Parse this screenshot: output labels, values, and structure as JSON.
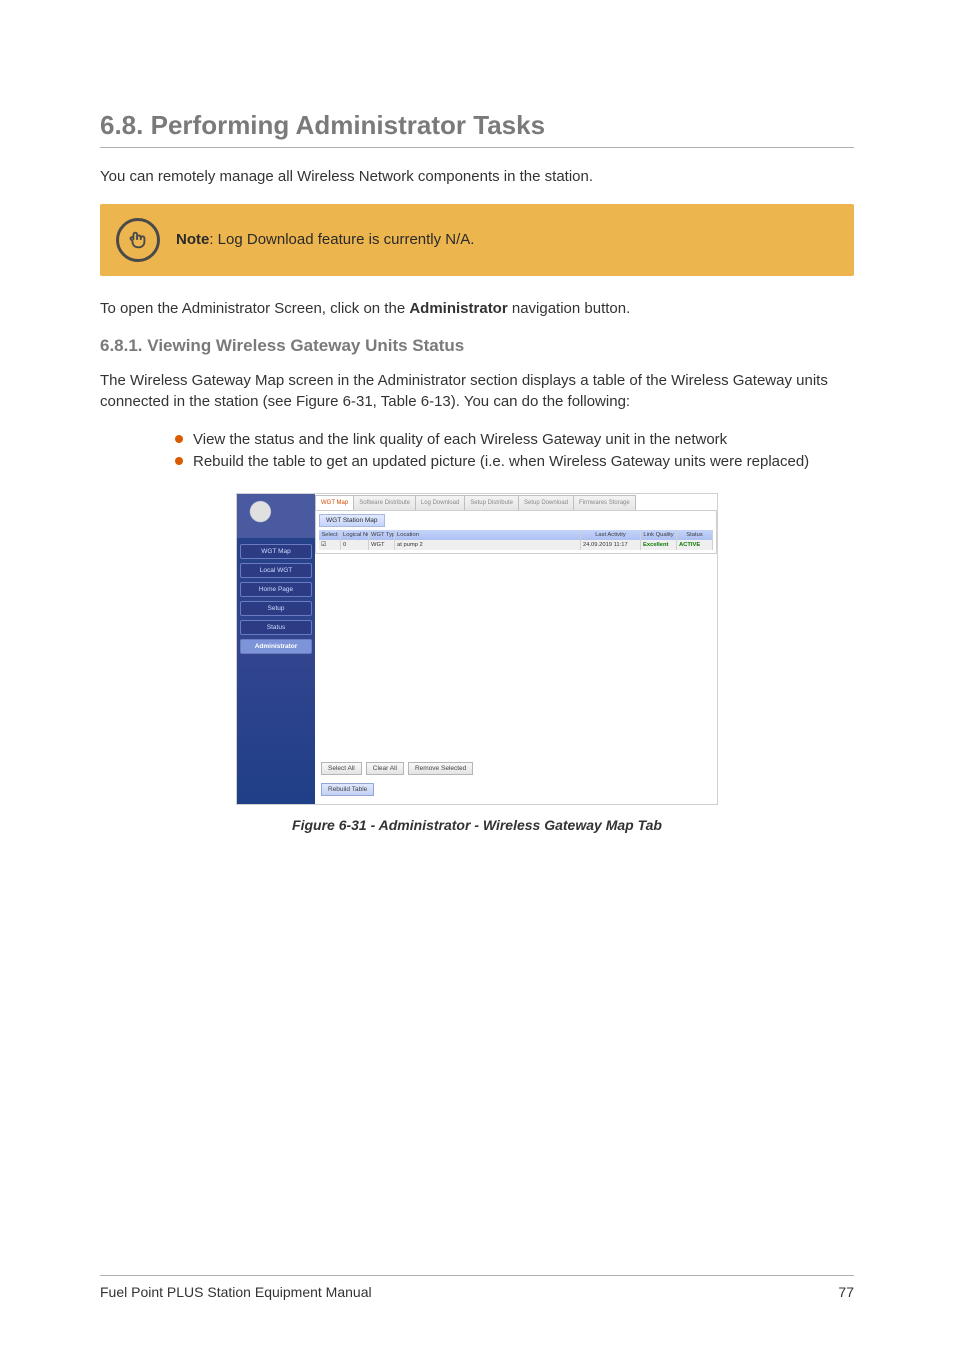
{
  "section": {
    "number": "6.8.",
    "title": "Performing Administrator Tasks"
  },
  "intro_paragraph": "You can remotely manage all Wireless Network components in the station.",
  "note": {
    "label": "Note",
    "text": ": Log Download feature is currently N/A.",
    "icon_name": "pointing-hand-icon"
  },
  "after_note_prefix": "To open the Administrator Screen, click on the ",
  "after_note_bold": "Administrator",
  "after_note_suffix": " navigation button.",
  "subsection": {
    "number": "6.8.1.",
    "title": "Viewing Wireless Gateway Units Status"
  },
  "subsection_paragraph": "The Wireless Gateway Map screen in the Administrator section displays a table of the Wireless Gateway units connected in the station (see Figure 6-31, Table 6-13). You can do the following:",
  "bullets": [
    "View the status and the link quality of each Wireless Gateway unit in the network",
    "Rebuild the table to get an updated picture (i.e. when Wireless Gateway units were replaced)"
  ],
  "embedded_app": {
    "nav_items": [
      {
        "label": "WGT Map",
        "active": false
      },
      {
        "label": "Local WGT",
        "active": false
      },
      {
        "label": "Home Page",
        "active": false
      },
      {
        "label": "Setup",
        "active": false
      },
      {
        "label": "Status",
        "active": false
      },
      {
        "label": "Administrator",
        "active": true
      }
    ],
    "tabs": [
      {
        "label": "WGT Map",
        "active": true
      },
      {
        "label": "Software Distribute",
        "active": false
      },
      {
        "label": "Log Download",
        "active": false
      },
      {
        "label": "Setup Distribute",
        "active": false
      },
      {
        "label": "Setup Download",
        "active": false
      },
      {
        "label": "Firmwares Storage",
        "active": false
      }
    ],
    "panel_title": "WGT Station Map",
    "table": {
      "headers": {
        "select": "Select",
        "logical_num": "Logical Num",
        "wgt_type": "WGT Type",
        "location": "Location",
        "last_activity": "Last Activity",
        "link_quality": "Link Quality",
        "status": "Status"
      },
      "rows": [
        {
          "select": true,
          "logical_num": "0",
          "wgt_type": "WGT",
          "location": "at pump 2",
          "last_activity": "24.09.2019 11:17",
          "link_quality": "Excellent",
          "status": "ACTIVE"
        }
      ]
    },
    "buttons": {
      "select_all": "Select All",
      "clear_all": "Clear All",
      "remove_selected": "Remove Selected",
      "rebuild_table": "Rebuild Table"
    }
  },
  "figure_caption": "Figure 6-31 - Administrator - Wireless Gateway Map Tab",
  "footer": {
    "doc_title": "Fuel Point PLUS Station Equipment Manual",
    "page_number": "77"
  }
}
